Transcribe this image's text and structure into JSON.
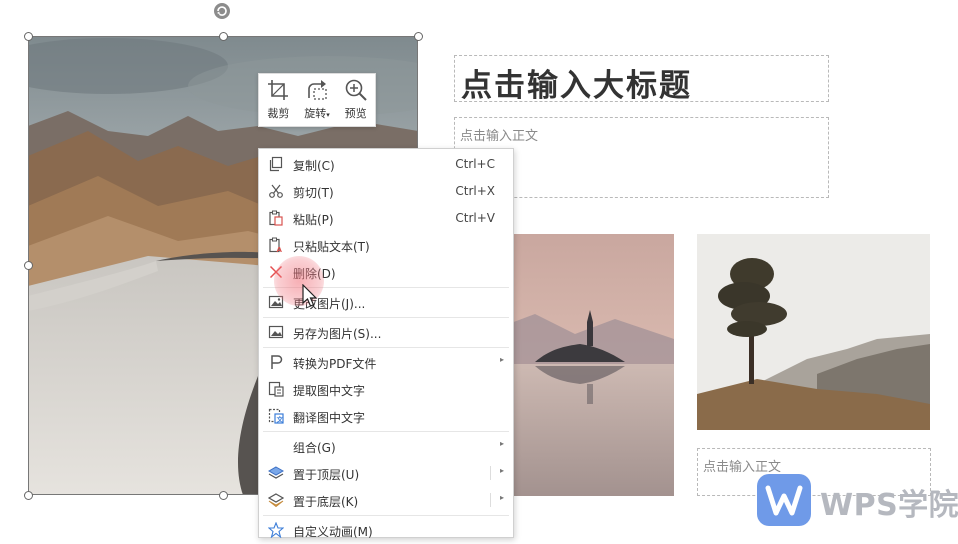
{
  "slide": {
    "title_placeholder": "点击输入大标题",
    "body_placeholder": "点击输入正文",
    "caption_placeholder": "点击输入正文"
  },
  "mini_toolbar": [
    {
      "label": "裁剪",
      "icon": "crop-icon"
    },
    {
      "label": "旋转",
      "icon": "rotate-icon",
      "has_dropdown": true
    },
    {
      "label": "预览",
      "icon": "zoom-in-icon"
    }
  ],
  "context_menu": {
    "items": [
      {
        "label": "复制(C)",
        "shortcut": "Ctrl+C",
        "icon": "copy-icon"
      },
      {
        "label": "剪切(T)",
        "shortcut": "Ctrl+X",
        "icon": "scissors-icon"
      },
      {
        "label": "粘贴(P)",
        "shortcut": "Ctrl+V",
        "icon": "paste-icon"
      },
      {
        "label": "只粘贴文本(T)",
        "icon": "paste-text-icon"
      },
      {
        "label": "删除(D)",
        "icon": "delete-icon"
      },
      {
        "label": "更改图片(J)...",
        "icon": "change-image-icon"
      },
      {
        "label": "另存为图片(S)...",
        "icon": "save-image-icon"
      },
      {
        "label": "转换为PDF文件",
        "icon": "pdf-icon",
        "has_submenu": true
      },
      {
        "label": "提取图中文字",
        "icon": "extract-text-icon"
      },
      {
        "label": "翻译图中文字",
        "icon": "translate-icon"
      },
      {
        "label": "组合(G)",
        "has_submenu": true
      },
      {
        "label": "置于顶层(U)",
        "icon": "bring-front-icon",
        "has_submenu": true
      },
      {
        "label": "置于底层(K)",
        "icon": "send-back-icon",
        "has_submenu": true
      },
      {
        "label": "自定义动画(M)",
        "icon": "animation-icon"
      }
    ]
  },
  "watermark": {
    "text": "WPS学院"
  },
  "colors": {
    "accent_delete": "#e55050",
    "wps_blue": "#6f9ae8",
    "menu_icon": "#555555"
  }
}
